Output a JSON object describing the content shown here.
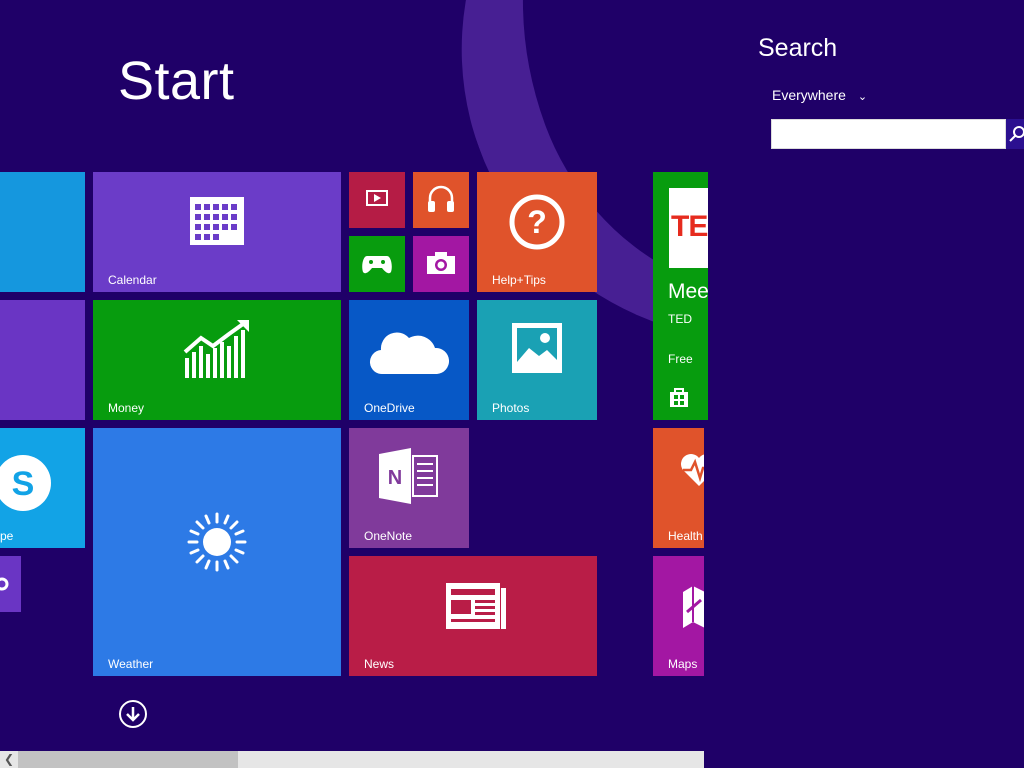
{
  "start": {
    "title": "Start"
  },
  "tiles": {
    "calendar": "Calendar",
    "help_tips": "Help+Tips",
    "money": "Money",
    "onedrive": "OneDrive",
    "photos": "Photos",
    "skype": "pe",
    "onenote": "OneNote",
    "weather": "Weather",
    "news": "News",
    "ted_headline": "Mee",
    "ted_publisher": "TED",
    "ted_price": "Free",
    "ted_logo": "TE",
    "health": "Health",
    "maps": "Maps"
  },
  "search": {
    "title": "Search",
    "scope": "Everywhere",
    "query": ""
  },
  "colors": {
    "background": "#1f0068",
    "calendar": "#6b3cc8",
    "money": "#079c0e",
    "onedrive": "#0758c6",
    "photos": "#1aa1b4",
    "weather": "#2d7ae6",
    "onenote": "#803a9b",
    "news": "#b91d47",
    "help": "#e0532b",
    "video": "#b51c45",
    "music": "#e0532b",
    "xbox": "#089c0e",
    "camera": "#a317a3"
  }
}
